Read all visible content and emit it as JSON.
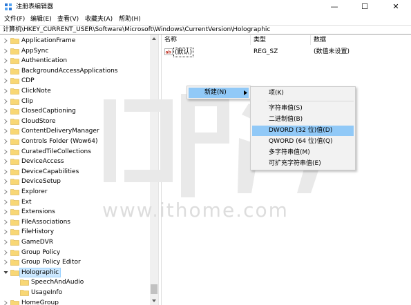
{
  "window": {
    "title": "注册表编辑器",
    "minimize_glyph": "—",
    "maximize_glyph": "☐",
    "close_glyph": "✕"
  },
  "menubar": {
    "file": "文件(F)",
    "edit": "编辑(E)",
    "view": "查看(V)",
    "favorites": "收藏夹(A)",
    "help": "帮助(H)"
  },
  "address": {
    "path": "计算机\\HKEY_CURRENT_USER\\Software\\Microsoft\\Windows\\CurrentVersion\\Holographic"
  },
  "tree": {
    "items": [
      {
        "label": "ApplicationFrame"
      },
      {
        "label": "AppSync"
      },
      {
        "label": "Authentication"
      },
      {
        "label": "BackgroundAccessApplications"
      },
      {
        "label": "CDP"
      },
      {
        "label": "ClickNote"
      },
      {
        "label": "Clip"
      },
      {
        "label": "ClosedCaptioning"
      },
      {
        "label": "CloudStore"
      },
      {
        "label": "ContentDeliveryManager"
      },
      {
        "label": "Controls Folder (Wow64)"
      },
      {
        "label": "CuratedTileCollections"
      },
      {
        "label": "DeviceAccess"
      },
      {
        "label": "DeviceCapabilities"
      },
      {
        "label": "DeviceSetup"
      },
      {
        "label": "Explorer"
      },
      {
        "label": "Ext"
      },
      {
        "label": "Extensions"
      },
      {
        "label": "FileAssociations"
      },
      {
        "label": "FileHistory"
      },
      {
        "label": "GameDVR"
      },
      {
        "label": "Group Policy"
      },
      {
        "label": "Group Policy Editor"
      },
      {
        "label": "Holographic",
        "selected": true
      },
      {
        "label": "SpeechAndAudio"
      },
      {
        "label": "UsageInfo"
      },
      {
        "label": "HomeGroup"
      }
    ]
  },
  "values": {
    "columns": {
      "name": "名称",
      "type": "类型",
      "data": "数据"
    },
    "rows": [
      {
        "name": "(默认)",
        "type": "REG_SZ",
        "data": "(数值未设置)"
      }
    ]
  },
  "context_menu": {
    "new_label": "新建(N)"
  },
  "submenu": {
    "key": "项(K)",
    "string": "字符串值(S)",
    "binary": "二进制值(B)",
    "dword": "DWORD (32 位)值(D)",
    "qword": "QWORD (64 位)值(Q)",
    "multi_string": "多字符串值(M)",
    "expandable_string": "可扩充字符串值(E)"
  },
  "watermark": {
    "text": "www.ithome.com"
  },
  "colors": {
    "selection": "#cce8ff",
    "menu_highlight": "#91c9f7",
    "folder": "#f8d775"
  }
}
